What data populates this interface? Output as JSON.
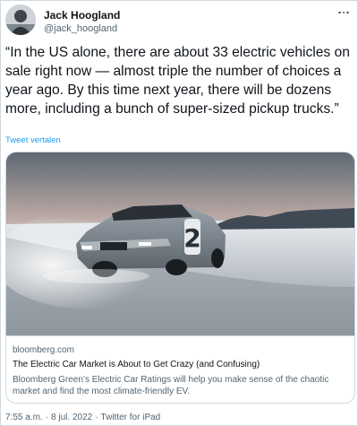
{
  "author": {
    "name": "Jack Hoogland",
    "handle": "@jack_hoogland"
  },
  "tweet": {
    "text": "“In the US alone, there are about 33 electric vehicles on sale right now — almost triple the number of choices a year ago. By this time next year, there will be dozens more, including a bunch of super-sized pickup trucks.”",
    "translate_label": "Tweet vertalen"
  },
  "link_card": {
    "domain": "bloomberg.com",
    "title": "The Electric Car Market is About to Get Crazy (and Confusing)",
    "description": "Bloomberg Green’s Electric Car Ratings will help you make sense of the chaotic market and find the most climate-friendly EV.",
    "car_number": "2"
  },
  "footer": {
    "time": "7:55 a.m.",
    "date": "8 jul. 2022",
    "source": "Twitter for iPad",
    "separator": "·"
  },
  "colors": {
    "link_blue": "#1d9bf0",
    "secondary_text": "#536471",
    "border": "#cfd9de"
  },
  "icons": {
    "more": "more-options-icon"
  }
}
